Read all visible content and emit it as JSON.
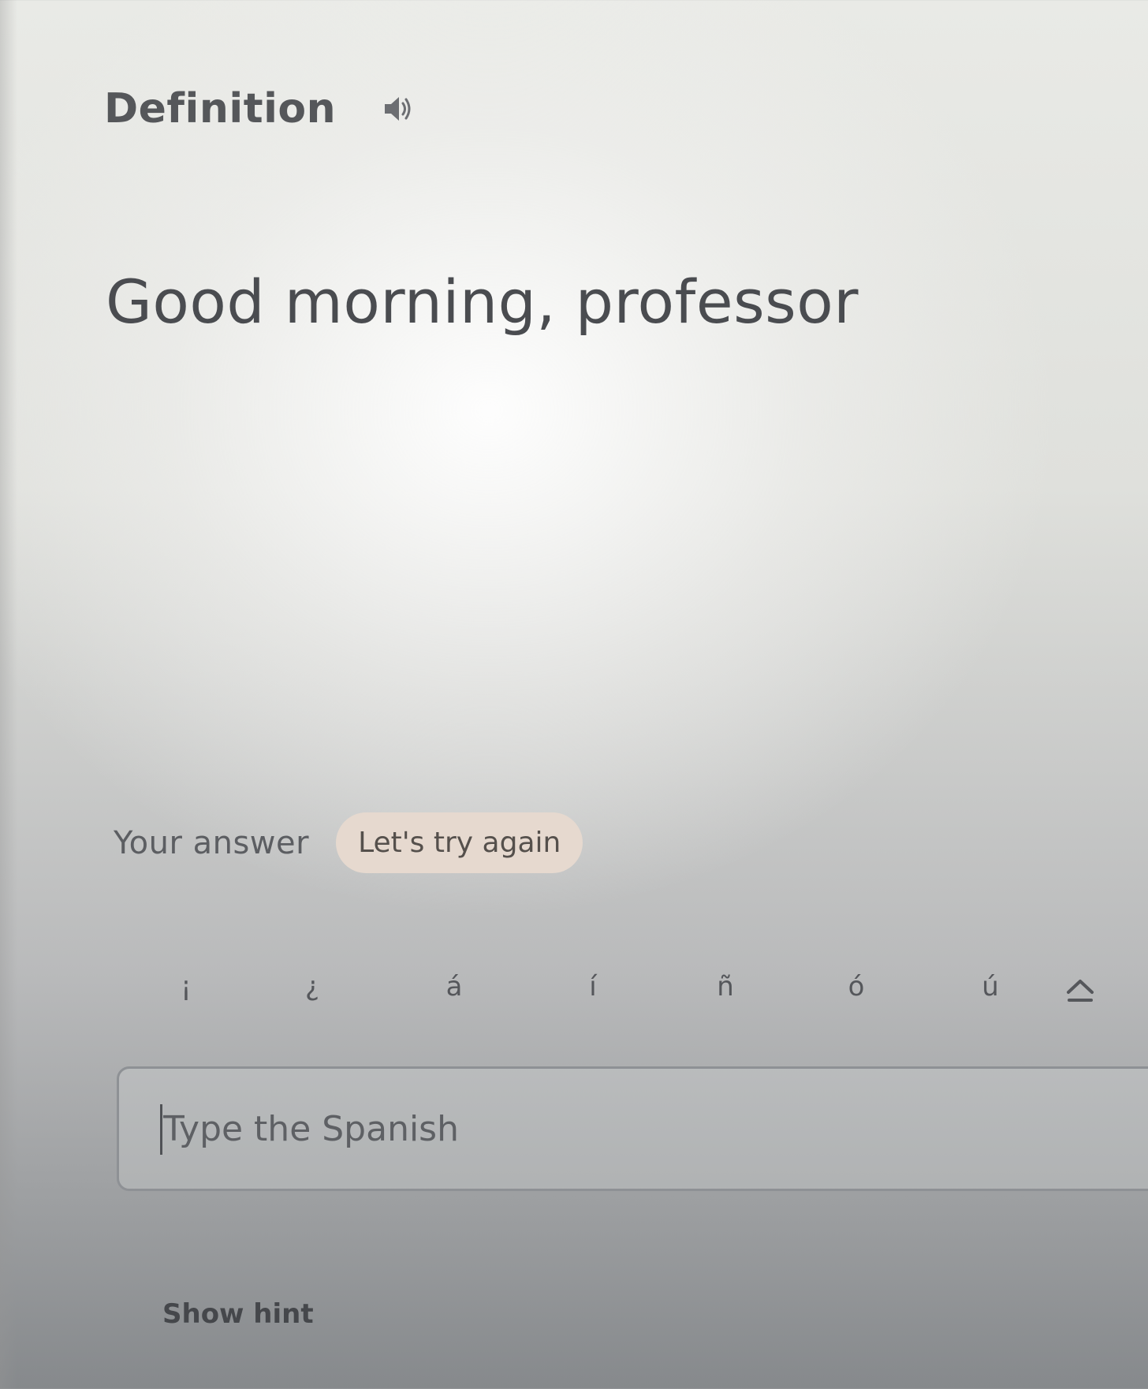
{
  "card": {
    "section_label": "Definition",
    "audio_icon": "speaker-icon",
    "term": "Good morning, professor"
  },
  "answer": {
    "label": "Your answer",
    "feedback": "Let's try again",
    "accent_keys": [
      "¡",
      "¿",
      "á",
      "í",
      "ñ",
      "ó",
      "ú"
    ],
    "toggle_icon": "caret-up-icon",
    "input": {
      "placeholder": "Type the Spanish",
      "value": ""
    },
    "hint_label": "Show hint"
  },
  "colors": {
    "feedback_badge_bg": "#e6d9cf",
    "text": "#55575a"
  }
}
